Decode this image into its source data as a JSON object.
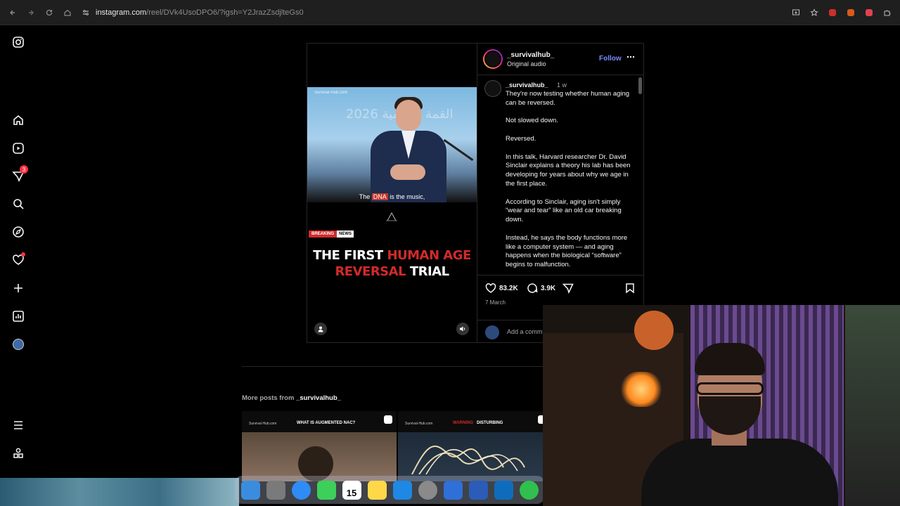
{
  "browser": {
    "url_domain": "instagram.com",
    "url_path": "/reel/DVk4UsoDPO6/?igsh=Y2JrazZsdjlteGs0"
  },
  "sidebar": {
    "messages_badge": "3"
  },
  "post": {
    "username": "_survivalhub_",
    "audio": "Original audio",
    "follow_label": "Follow",
    "caption_user": "_survivalhub_",
    "caption_time": "1 w",
    "caption_paragraphs": [
      "They're now testing whether human aging can be reversed.",
      "Not slowed down.",
      "Reversed.",
      "In this talk, Harvard researcher Dr. David Sinclair explains a theory his lab has been developing for years about why we age in the first place.",
      "According to Sinclair, aging isn't simply “wear and tear” like an old car breaking down.",
      "Instead, he says the body functions more like a computer system — and aging happens when the biological “software” begins to malfunction."
    ],
    "likes": "83.2K",
    "comments": "3.9K",
    "date": "7 March",
    "comment_placeholder": "Add a comm"
  },
  "video": {
    "watermark": "Survival-Hub.com",
    "background_text": "القمة العالمية 2026",
    "subtitle_pre": "The ",
    "subtitle_highlight": "DNA",
    "subtitle_post": " is the music,",
    "tag_red": "BREAKING",
    "tag_white": "NEWS",
    "headline_1a": "THE FIRST ",
    "headline_1b": "HUMAN AGE",
    "headline_2a": "REVERSAL",
    "headline_2b": " TRIAL"
  },
  "more_posts": {
    "prefix": "More posts from ",
    "user": "_survivalhub_",
    "thumb1_site": "Survival-Hub.com",
    "thumb1_title": "WHAT IS AUGMENTED NAC?",
    "thumb2_site": "Survival-Hub.com",
    "thumb2_title_red": "WARNING",
    "thumb2_title": "DISTURBING"
  },
  "dock": {
    "calendar_day": "15",
    "app_colors": [
      "#3a8dde",
      "#7a7a7a",
      "#2f8bf5",
      "#3ccf5a",
      "#ffffff",
      "#ffd84a",
      "#1e88e5",
      "#8a8a8a",
      "#2f6fd8",
      "#2b5cb8",
      "#0f6cbd",
      "#30c04f"
    ]
  }
}
